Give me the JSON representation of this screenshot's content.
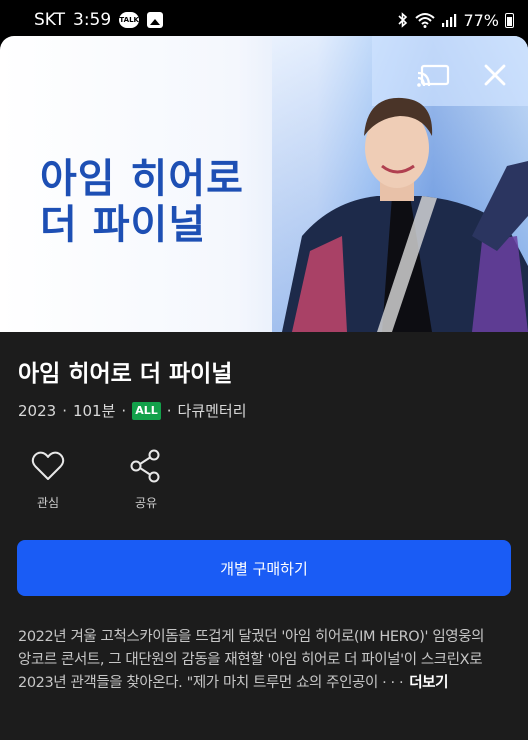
{
  "status_bar": {
    "carrier": "SKT",
    "time": "3:59",
    "talk_badge": "TALK",
    "battery": "77%"
  },
  "poster": {
    "title_line1": "아임 히어로",
    "title_line2": "더 파이널"
  },
  "movie": {
    "title": "아임 히어로 더 파이널",
    "year": "2023",
    "runtime": "101분",
    "rating": "ALL",
    "genre": "다큐멘터리",
    "separator": "·"
  },
  "actions": {
    "like_label": "관심",
    "share_label": "공유"
  },
  "buy_button": "개별 구매하기",
  "description": {
    "line1": "2022년 겨울 고척스카이돔을 뜨겁게 달궜던 '아임 히어로(IM HERO)' 임영웅의",
    "line2": "앙코르 콘서트, 그 대단원의 감동을 재현할 '아임 히어로 더 파이널'이 스크린X로",
    "line3": "2023년 관객들을 찾아온다. \"제가 마치 트루먼 쇼의 주인공이  ·  ·  ·",
    "more": "더보기"
  },
  "colors": {
    "accent": "#1a5cf5",
    "rating_badge": "#13a14b",
    "poster_title": "#1d4fb4",
    "sheet_bg": "#1c1c1c"
  }
}
